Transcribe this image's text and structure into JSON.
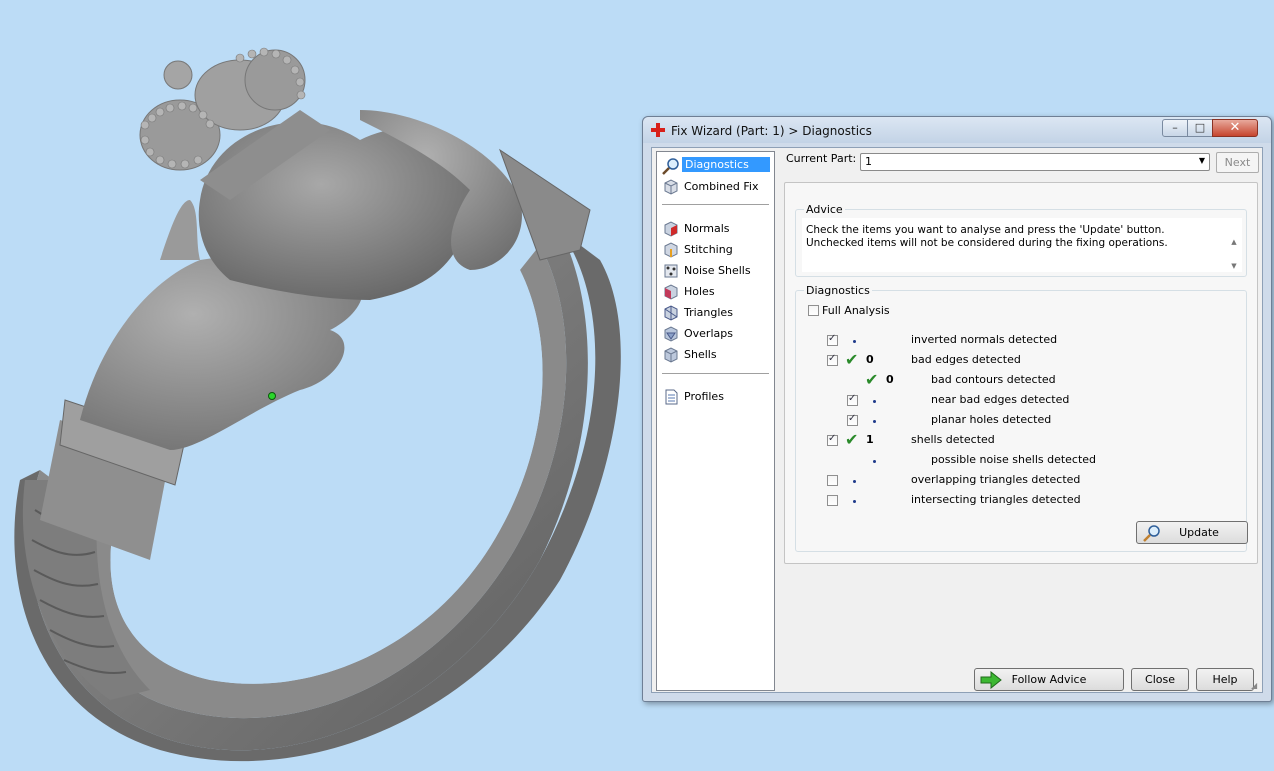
{
  "window": {
    "title": "Fix Wizard (Part: 1) > Diagnostics",
    "minimize": "–",
    "maximize": "□",
    "close": "✕"
  },
  "nav": [
    {
      "label": "Diagnostics",
      "icon": "magnifier-icon",
      "selected": true
    },
    {
      "label": "Combined Fix",
      "icon": "cube-icon"
    },
    {
      "label": "Normals",
      "icon": "normals-cube-icon"
    },
    {
      "label": "Stitching",
      "icon": "stitching-cube-icon"
    },
    {
      "label": "Noise Shells",
      "icon": "noise-shells-icon"
    },
    {
      "label": "Holes",
      "icon": "holes-cube-icon"
    },
    {
      "label": "Triangles",
      "icon": "triangles-cube-icon"
    },
    {
      "label": "Overlaps",
      "icon": "overlaps-cube-icon"
    },
    {
      "label": "Shells",
      "icon": "shells-cube-icon"
    },
    {
      "label": "Profiles",
      "icon": "document-icon"
    }
  ],
  "current_part": {
    "label": "Current Part:",
    "value": "1",
    "next_label": "Next"
  },
  "advice": {
    "title": "Advice",
    "text": "Check the items you want to analyse and press the 'Update' button. Unchecked items will not be considered during the fixing operations."
  },
  "diagnostics": {
    "title": "Diagnostics",
    "full_analysis": {
      "label": "Full Analysis",
      "checked": false
    },
    "items": [
      {
        "label": "inverted normals detected",
        "checked": true,
        "count": "",
        "ok": false
      },
      {
        "label": "bad edges detected",
        "checked": true,
        "count": "0",
        "ok": true
      },
      {
        "label": "bad contours detected",
        "checked": null,
        "count": "0",
        "ok": true
      },
      {
        "label": "near bad edges detected",
        "checked": true,
        "count": "",
        "ok": false
      },
      {
        "label": "planar holes detected",
        "checked": true,
        "count": "",
        "ok": false
      },
      {
        "label": "shells detected",
        "checked": true,
        "count": "1",
        "ok": true
      },
      {
        "label": "possible noise shells detected",
        "checked": null,
        "count": "",
        "ok": false
      },
      {
        "label": "overlapping triangles detected",
        "checked": false,
        "count": "",
        "ok": false
      },
      {
        "label": "intersecting triangles detected",
        "checked": false,
        "count": "",
        "ok": false
      }
    ],
    "update_label": "Update"
  },
  "footer": {
    "follow_advice": "Follow Advice",
    "close": "Close",
    "help": "Help"
  },
  "colors": {
    "background": "#bcdcf6",
    "model": "#8c8c8c",
    "selection": "#3399ff",
    "check": "#2a8a2a"
  }
}
